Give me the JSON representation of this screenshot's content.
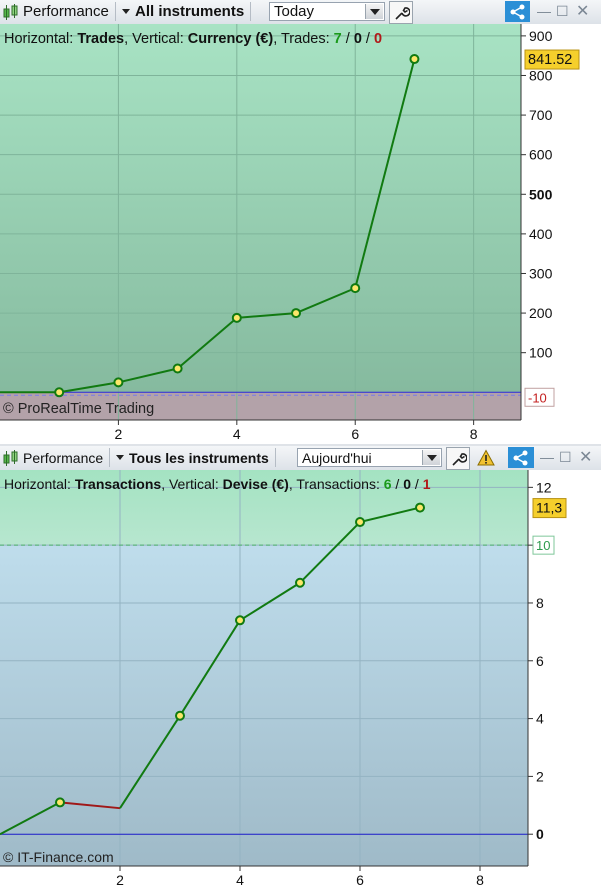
{
  "panel1": {
    "toolbar": {
      "title": "Performance",
      "instrument": "All instruments",
      "period": "Today"
    },
    "info": {
      "horizontal_label": "Horizontal: ",
      "horizontal_value": "Trades",
      "vertical_label": ", Vertical: ",
      "vertical_value": "Currency (€)",
      "count_label": ", Trades: ",
      "wins": "7",
      "sep1": " / ",
      "neutral": "0",
      "sep2": " / ",
      "losses": "0"
    },
    "copyright": "© ProRealTime Trading",
    "last_value_label": "841.52",
    "zero_marker_label": "-10",
    "zero_marker_hidden_label": "10",
    "colors": {
      "line": "#117a11",
      "marker_fill": "#fce76a",
      "grid": "#7fb49a"
    }
  },
  "panel2": {
    "toolbar": {
      "title": "Performance",
      "instrument": "Tous les instruments",
      "period": "Aujourd'hui"
    },
    "info": {
      "horizontal_label": "Horizontal: ",
      "horizontal_value": "Transactions",
      "vertical_label": ", Vertical: ",
      "vertical_value": "Devise (€)",
      "count_label": ", Transactions: ",
      "wins": "6",
      "sep1": " / ",
      "neutral": "0",
      "sep2": " / ",
      "losses": "1"
    },
    "copyright": "© IT-Finance.com",
    "last_value_label": "11,3",
    "threshold_label": "10",
    "colors": {
      "line": "#117a11",
      "loss_line": "#a01818",
      "marker_fill": "#fce76a"
    }
  },
  "chart_data": [
    {
      "type": "line",
      "xlim": [
        0,
        8.8
      ],
      "ylim": [
        -70,
        930
      ],
      "x_ticks": [
        2,
        4,
        6,
        8
      ],
      "y_ticks": [
        100,
        200,
        300,
        400,
        500,
        600,
        700,
        800,
        900
      ],
      "y_tick_labels": [
        "100",
        "200",
        "300",
        "400",
        "500",
        "600",
        "700",
        "800",
        "900"
      ],
      "bold_y_tick": 500,
      "x": [
        0,
        1,
        2,
        3,
        4,
        5,
        6,
        7
      ],
      "y": [
        0,
        0,
        25,
        60,
        188,
        200,
        263,
        841.52
      ],
      "grid": true
    },
    {
      "type": "line",
      "xlim": [
        0,
        8.8
      ],
      "ylim": [
        -1.1,
        12.6
      ],
      "x_ticks": [
        2,
        4,
        6,
        8
      ],
      "y_ticks": [
        0,
        2,
        4,
        6,
        8,
        10,
        12
      ],
      "y_tick_labels": [
        "0",
        "2",
        "4",
        "6",
        "8",
        "",
        "12"
      ],
      "bold_y_tick": 0,
      "x": [
        0,
        1,
        2,
        3,
        4,
        5,
        6,
        7
      ],
      "y": [
        0,
        1.1,
        0.9,
        4.1,
        7.4,
        8.7,
        10.8,
        11.3
      ],
      "loss_segment": [
        1,
        2
      ],
      "threshold": 10,
      "grid": true
    }
  ]
}
